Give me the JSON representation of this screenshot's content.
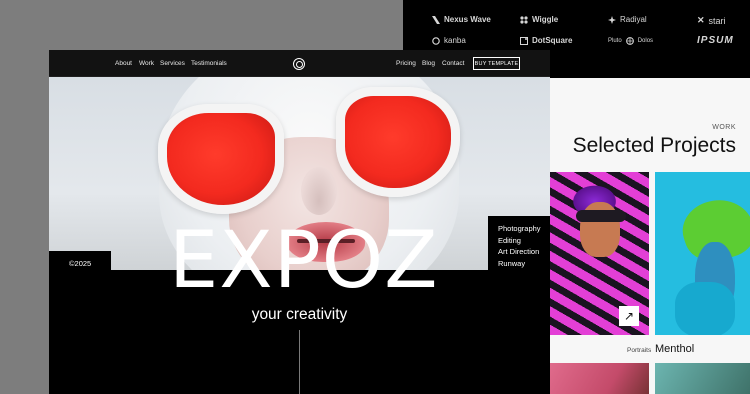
{
  "back_window": {
    "client_logos": [
      "Nexus Wave",
      "Wiggle",
      "Radiyal",
      "stari",
      "kanba",
      "DotSquare",
      "Pluto",
      "IPSUM"
    ],
    "section_label": "WORK",
    "section_title": "Selected Projects",
    "project_arrow": "↗",
    "featured_category": "Portraits",
    "featured_name": "Menthol"
  },
  "site": {
    "nav": {
      "links": [
        "About",
        "Work",
        "Services",
        "Testimonials"
      ],
      "right_links": [
        "Pricing",
        "Blog",
        "Contact"
      ],
      "cta": "BUY TEMPLATE"
    },
    "hero": {
      "brand": "EXPOZ",
      "tagline": "your creativity",
      "year": "©2025",
      "categories": [
        "Photography",
        "Editing",
        "Art Direction",
        "Runway"
      ]
    }
  },
  "colors": {
    "accent_red": "#f32a1f",
    "bg_dark": "#000000",
    "panel_light": "#f7f7f7"
  }
}
